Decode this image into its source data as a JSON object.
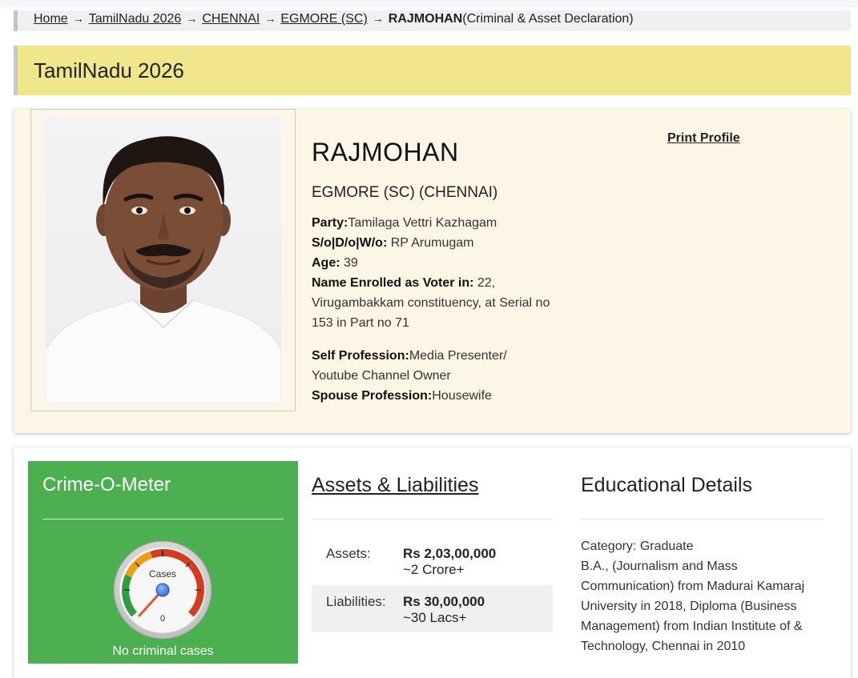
{
  "breadcrumb": {
    "items": [
      "Home",
      "TamilNadu 2026",
      "CHENNAI",
      "EGMORE (SC)"
    ],
    "separator": "→",
    "current": "RAJMOHAN",
    "current_suffix": "(Criminal & Asset Declaration)"
  },
  "banner": {
    "title": "TamilNadu 2026"
  },
  "profile": {
    "print_label": "Print Profile",
    "name": "RAJMOHAN",
    "constituency": "EGMORE (SC) (CHENNAI)",
    "party_label": "Party:",
    "party": "Tamilaga Vettri Kazhagam",
    "relation_label": "S/o|D/o|W/o:",
    "relation": " RP Arumugam",
    "age_label": "Age:",
    "age": " 39",
    "voter_label": "Name Enrolled as Voter in:",
    "voter": " 22, Virugambakkam constituency, at Serial no 153 in Part no 71",
    "self_prof_label": "Self Profession:",
    "self_prof": "Media Presenter/ Youtube Channel Owner",
    "spouse_prof_label": "Spouse Profession:",
    "spouse_prof": "Housewife"
  },
  "crime": {
    "title": "Crime-O-Meter",
    "gauge_label": "Cases",
    "gauge_value": "0",
    "status": "No criminal cases"
  },
  "assets": {
    "title": "Assets & Liabilities",
    "assets_label": "Assets:",
    "assets_value": "Rs 2,03,00,000",
    "assets_approx": "~2 Crore+",
    "liabilities_label": "Liabilities:",
    "liabilities_value": "Rs 30,00,000",
    "liabilities_approx": "~30 Lacs+"
  },
  "education": {
    "title": "Educational Details",
    "category": "Category: Graduate",
    "details": "B.A., (Journalism and Mass Communication) from Madurai Kamaraj University in 2018, Diploma (Business Management) from Indian Institute of & Technology, Chennai in 2010"
  },
  "colors": {
    "banner_bg": "#f0e68c",
    "profile_bg": "#fdf5e6",
    "crime_bg": "#4caf50",
    "gauge_green": "#2e9e3e",
    "gauge_orange": "#f39c12",
    "gauge_red": "#d63a1f",
    "needle": "#e8572a"
  }
}
